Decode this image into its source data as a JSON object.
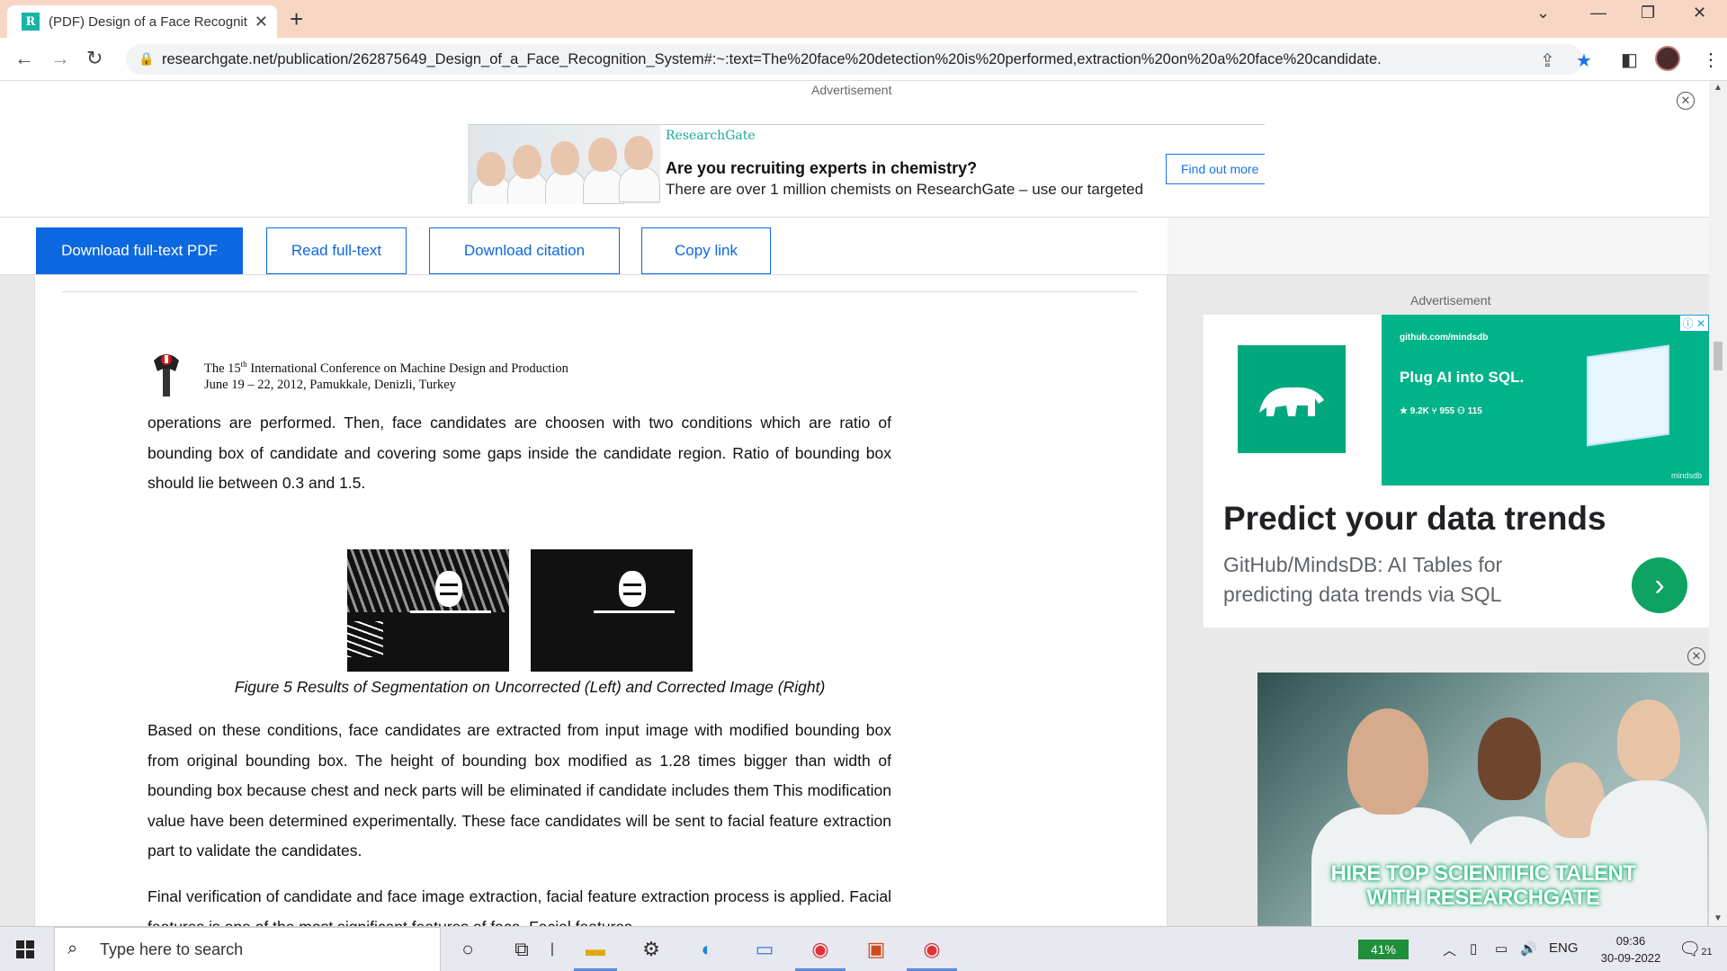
{
  "browser": {
    "tab_title": "(PDF) Design of a Face Recognitic",
    "url": "researchgate.net/publication/262875649_Design_of_a_Face_Recognition_System#:~:text=The%20face%20detection%20is%20performed,extraction%20on%20a%20face%20candidate."
  },
  "top_ad": {
    "label": "Advertisement",
    "brand": "ResearchGate",
    "title": "Are you recruiting experts in chemistry?",
    "subtitle": "There are over 1 million chemists on ResearchGate – use our targeted",
    "button": "Find out more"
  },
  "actions": {
    "download_pdf": "Download full-text PDF",
    "read_full": "Read full-text",
    "download_citation": "Download citation",
    "copy_link": "Copy link"
  },
  "document": {
    "conf_line1_a": "The 15",
    "conf_line1_sup": "th",
    "conf_line1_b": " International Conference on Machine Design and Production",
    "conf_line2": "June 19 – 22, 2012, Pamukkale, Denizli, Turkey",
    "para1": "operations are performed. Then, face candidates are choosen with two conditions which are ratio of bounding box of candidate and covering some gaps inside the candidate region. Ratio of bounding box should lie between 0.3 and 1.5.",
    "caption": "Figure 5 Results of Segmentation on Uncorrected (Left) and Corrected Image (Right)",
    "para2": "Based on these conditions, face candidates are extracted from input image with modified bounding box from original bounding box. The height of bounding box modified as 1.28 times bigger than width of bounding box because chest and neck parts will be eliminated if candidate includes them This modification value have been determined experimentally. These face candidates will be sent to facial feature extraction part to validate the candidates.",
    "para3": "Final verification of candidate and face image extraction, facial feature extraction process is applied. Facial features is one of the most significant features of face. Facial features"
  },
  "side_ad": {
    "label": "Advertisement",
    "github": "github.com/mindsdb",
    "headline_small": "Plug AI into SQL.",
    "stats": "★ 9.2K   ⑂ 955   ⚇ 115",
    "brand_foot": "mindsdb",
    "title": "Predict your data trends",
    "subtitle": "GitHub/MindsDB: AI Tables for predicting data trends via SQL"
  },
  "video_ad": {
    "line1": "HIRE TOP SCIENTIFIC TALENT",
    "line2": "WITH RESEARCHGATE"
  },
  "taskbar": {
    "search_placeholder": "Type here to search",
    "battery": "41%",
    "language": "ENG",
    "time": "09:36",
    "date": "30-09-2022",
    "notifications": "21"
  }
}
